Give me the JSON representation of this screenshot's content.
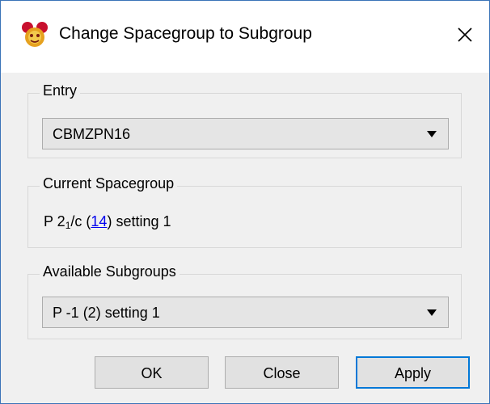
{
  "window": {
    "title": "Change Spacegroup to Subgroup",
    "app_icon": "mercury-app-icon",
    "close_icon": "close-icon"
  },
  "entry": {
    "group_label": "Entry",
    "selected_value": "CBMZPN16",
    "dropdown_icon": "chevron-down-icon"
  },
  "current_spacegroup": {
    "group_label": "Current Spacegroup",
    "symbol_prefix": "P 2",
    "subscript": "1",
    "symbol_suffix": "/c",
    "open_paren": " (",
    "number": "14",
    "close_paren": ")",
    "setting": " setting 1"
  },
  "subgroups": {
    "group_label": "Available Subgroups",
    "selected_value": "P -1 (2) setting 1",
    "dropdown_icon": "chevron-down-icon"
  },
  "buttons": {
    "ok": "OK",
    "close": "Close",
    "apply": "Apply"
  },
  "colors": {
    "link": "#0000ee",
    "focus_border": "#0078d7",
    "window_border": "#3a73b8"
  }
}
